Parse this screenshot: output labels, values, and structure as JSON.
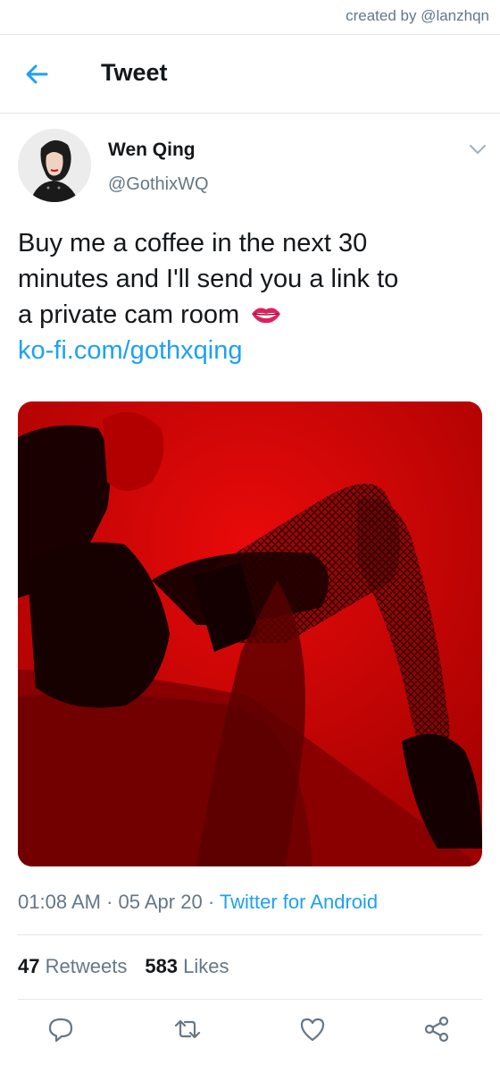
{
  "credit": "created by @lanzhqn",
  "header": {
    "title": "Tweet",
    "back_icon": "arrow-left-icon"
  },
  "tweet": {
    "display_name": "Wen Qing",
    "handle": "@GothixWQ",
    "text_line1": "Buy me a coffee in the next 30",
    "text_line2": "minutes and I'll send you a link to",
    "text_line3": "a private cam room",
    "emoji": "👄",
    "link": "ko-fi.com/gothxqing",
    "time": "01:08 AM",
    "sep1": " · ",
    "date": "05 Apr 20",
    "sep2": " · ",
    "source": "Twitter for Android"
  },
  "stats": {
    "retweets_count": "47",
    "retweets_label": "Retweets",
    "likes_count": "583",
    "likes_label": "Likes"
  },
  "actions": [
    "reply-icon",
    "retweet-icon",
    "like-icon",
    "share-icon"
  ],
  "colors": {
    "accent": "#1da1f2",
    "muted": "#657786",
    "text": "#14171a",
    "divider": "#e1e8ed",
    "media_red": "#c40000"
  }
}
